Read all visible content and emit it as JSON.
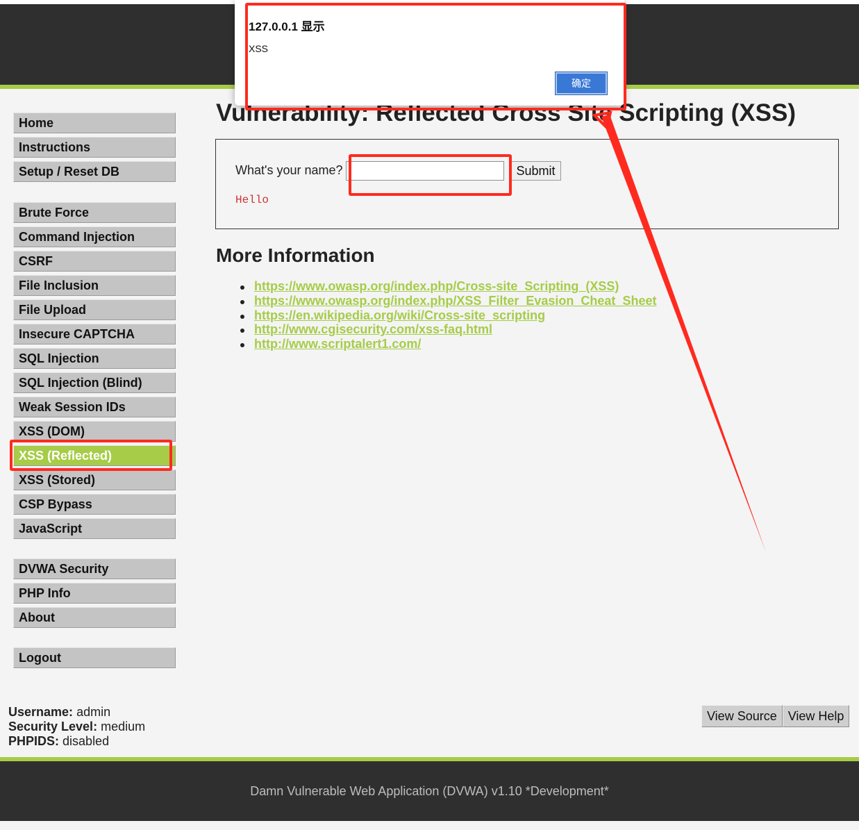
{
  "menu": {
    "group1": [
      "Home",
      "Instructions",
      "Setup / Reset DB"
    ],
    "group2": [
      "Brute Force",
      "Command Injection",
      "CSRF",
      "File Inclusion",
      "File Upload",
      "Insecure CAPTCHA",
      "SQL Injection",
      "SQL Injection (Blind)",
      "Weak Session IDs",
      "XSS (DOM)",
      "XSS (Reflected)",
      "XSS (Stored)",
      "CSP Bypass",
      "JavaScript"
    ],
    "group3": [
      "DVWA Security",
      "PHP Info",
      "About"
    ],
    "group4": [
      "Logout"
    ],
    "selected": "XSS (Reflected)"
  },
  "main": {
    "title": "Vulnerability: Reflected Cross Site Scripting (XSS)",
    "form": {
      "label": "What's your name?",
      "input_value": "",
      "submit_label": "Submit",
      "output": "Hello"
    },
    "more_info_title": "More Information",
    "links": [
      "https://www.owasp.org/index.php/Cross-site_Scripting_(XSS)",
      "https://www.owasp.org/index.php/XSS_Filter_Evasion_Cheat_Sheet",
      "https://en.wikipedia.org/wiki/Cross-site_scripting",
      "http://www.cgisecurity.com/xss-faq.html",
      "http://www.scriptalert1.com/"
    ]
  },
  "user_info": {
    "username_label": "Username:",
    "username": "admin",
    "security_label": "Security Level:",
    "security": "medium",
    "phpids_label": "PHPIDS:",
    "phpids": "disabled"
  },
  "buttons": {
    "view_source": "View Source",
    "view_help": "View Help"
  },
  "footer": {
    "text": "Damn Vulnerable Web Application (DVWA) v1.10 *Development*"
  },
  "alert": {
    "title": "127.0.0.1 显示",
    "message": "XSS",
    "ok_label": "确定"
  },
  "colors": {
    "accent": "#a6cc48",
    "header_bg": "#2f2f2f",
    "annotation": "#ff2a1f"
  }
}
